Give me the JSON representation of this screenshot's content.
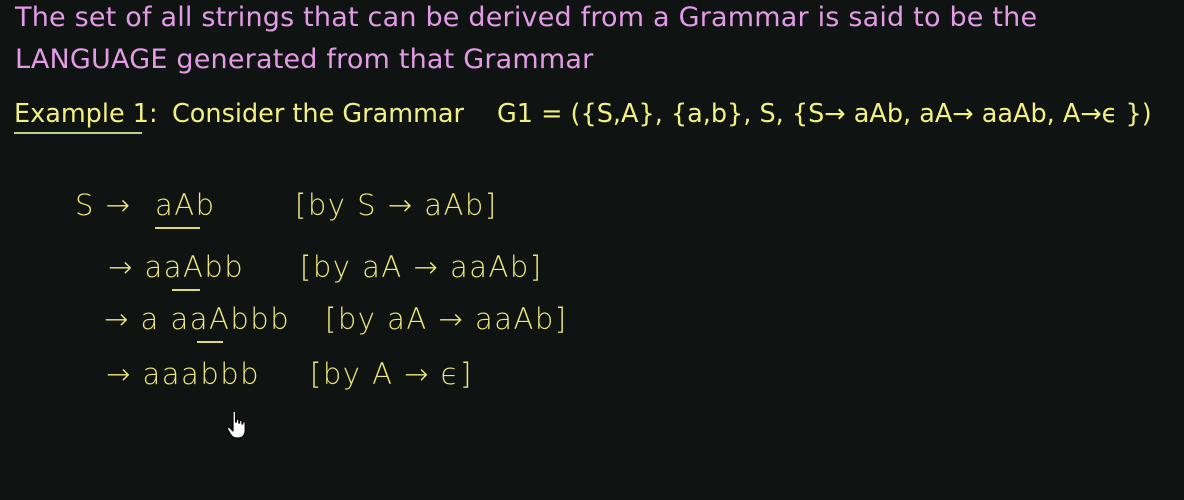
{
  "definition": {
    "line1": "The set of all strings that can be derived from a Grammar is said to be the",
    "line2": "LANGUAGE generated from that Grammar"
  },
  "example": {
    "label": "Example 1:",
    "text": "Consider the Grammar",
    "grammar": "G1 = ({S,A}, {a,b}, S, {S→ aAb, aA→ aaAb, A→ϵ })"
  },
  "derivation": [
    {
      "lhs": "S →",
      "rhs": "aAb",
      "reason": "[by S → aAb]"
    },
    {
      "lhs": "",
      "rhs": "→ aaAbb",
      "reason": "[by aA → aaAb]"
    },
    {
      "lhs": "",
      "rhs": "→ a aaAbbb",
      "reason": "[by aA → aaAb]"
    },
    {
      "lhs": "",
      "rhs": "→ aaabbb",
      "reason": "[by A → ϵ]"
    }
  ],
  "colors": {
    "background": "#0f1413",
    "definition_text": "#e39be6",
    "example_text": "#f2f07e",
    "handwriting": "#f0e878"
  },
  "icons": [
    "hand-pointer-cursor-icon"
  ]
}
